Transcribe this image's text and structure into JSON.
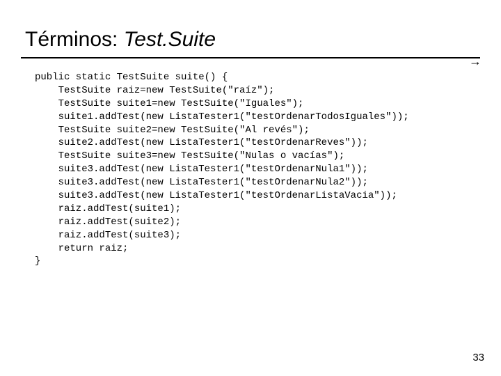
{
  "title": {
    "prefix": "Términos: ",
    "emphasis": "Test.Suite"
  },
  "arrow_glyph": "→",
  "code": {
    "l0": "public static TestSuite suite() {",
    "l1": "    TestSuite raiz=new TestSuite(\"raíz\");",
    "l2": "    TestSuite suite1=new TestSuite(\"Iguales\");",
    "l3": "    suite1.addTest(new ListaTester1(\"testOrdenarTodosIguales\"));",
    "l4": "    TestSuite suite2=new TestSuite(\"Al revés\");",
    "l5": "    suite2.addTest(new ListaTester1(\"testOrdenarReves\"));",
    "l6": "    TestSuite suite3=new TestSuite(\"Nulas o vacías\");",
    "l7": "    suite3.addTest(new ListaTester1(\"testOrdenarNula1\"));",
    "l8": "    suite3.addTest(new ListaTester1(\"testOrdenarNula2\"));",
    "l9": "    suite3.addTest(new ListaTester1(\"testOrdenarListaVacia\"));",
    "l10": "    raiz.addTest(suite1);",
    "l11": "    raiz.addTest(suite2);",
    "l12": "    raiz.addTest(suite3);",
    "l13": "    return raiz;",
    "l14": "}"
  },
  "page_number": "33"
}
